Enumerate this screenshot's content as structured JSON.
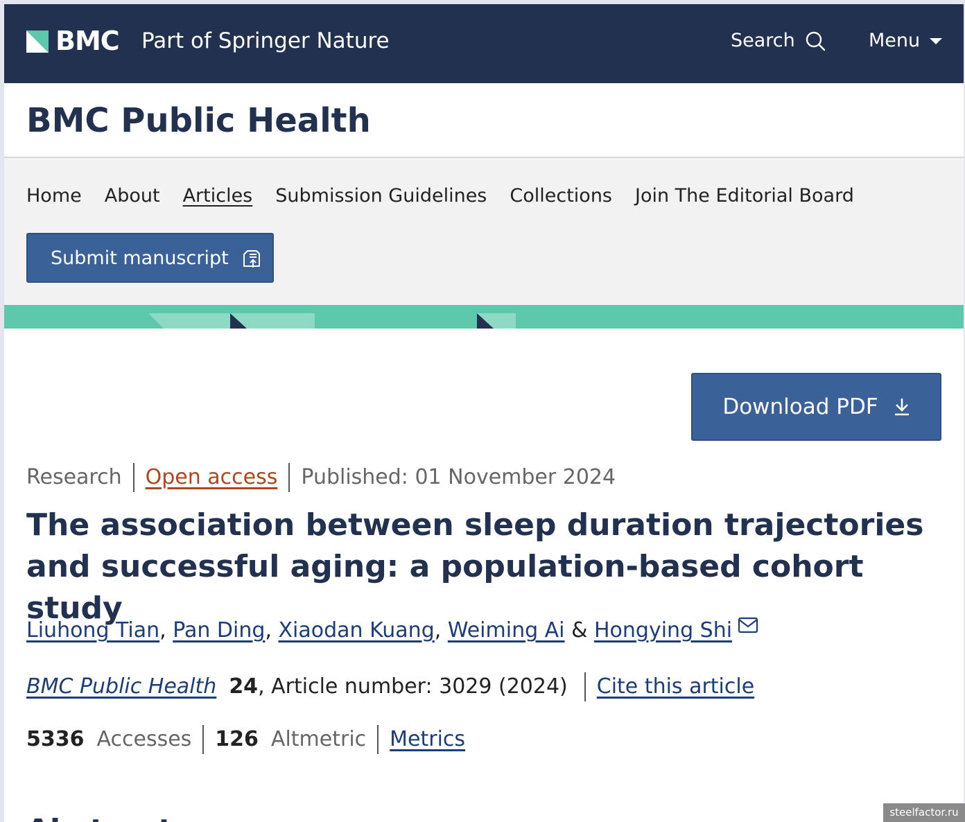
{
  "header": {
    "logo_text": "BMC",
    "tagline": "Part of Springer Nature",
    "search_label": "Search",
    "menu_label": "Menu"
  },
  "journal": {
    "title": "BMC Public Health"
  },
  "nav": {
    "items": [
      {
        "label": "Home"
      },
      {
        "label": "About"
      },
      {
        "label": "Articles"
      },
      {
        "label": "Submission Guidelines"
      },
      {
        "label": "Collections"
      },
      {
        "label": "Join The Editorial Board"
      }
    ],
    "submit_label": "Submit manuscript"
  },
  "article": {
    "download_label": "Download PDF",
    "type": "Research",
    "access": "Open access",
    "published": "Published: 01 November 2024",
    "title": "The association between sleep duration trajectories and successful aging: a population-based cohort study",
    "authors": [
      "Liuhong Tian",
      "Pan Ding",
      "Xiaodan Kuang",
      "Weiming Ai",
      "Hongying Shi"
    ],
    "author_sep": ", ",
    "author_last_sep": " & ",
    "journal_link": "BMC Public Health",
    "volume": "24",
    "article_number_text": ", Article number: 3029 (2024)",
    "cite_label": "Cite this article",
    "accesses_count": "5336",
    "accesses_label": "Accesses",
    "altmetric_count": "126",
    "altmetric_label": "Altmetric",
    "metrics_label": "Metrics",
    "next_heading": "Abstract"
  },
  "watermark": "steelfactor.ru",
  "colors": {
    "header_bg": "#21314f",
    "button_bg": "#3a6299",
    "accent_teal": "#5ec8ad",
    "open_access": "#b1461e",
    "link": "#1b3d7a"
  }
}
